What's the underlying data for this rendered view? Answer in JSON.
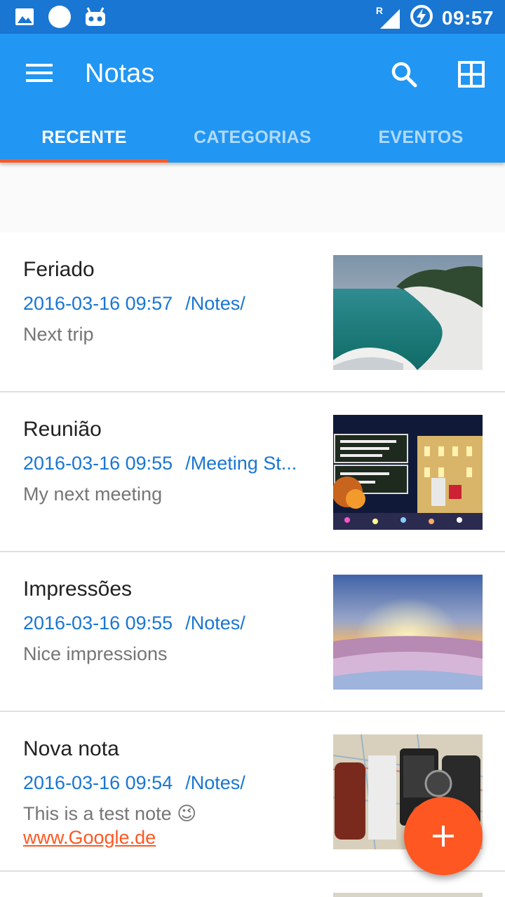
{
  "status_bar": {
    "time": "09:57",
    "left_icons": [
      "image-icon",
      "circle-icon",
      "robot-icon"
    ],
    "right_icons": [
      "signal-roaming-icon",
      "battery-charging-icon"
    ],
    "roaming_label": "R"
  },
  "appbar": {
    "title": "Notas",
    "menu_icon": "hamburger-menu-icon",
    "search_icon": "search-icon",
    "layout_icon": "grid-view-icon",
    "color": "#2196F3",
    "status_color": "#1976D2"
  },
  "tabs": [
    {
      "label": "RECENTE",
      "active": true
    },
    {
      "label": "CATEGORIAS",
      "active": false
    },
    {
      "label": "EVENTOS",
      "active": false
    }
  ],
  "accent_color": "#FF5722",
  "notes": [
    {
      "title": "Feriado",
      "date": "2016-03-16 09:57",
      "category": "/Notes/",
      "body": "Next trip",
      "link": "",
      "thumb": "coastline"
    },
    {
      "title": "Reunião",
      "date": "2016-03-16 09:55",
      "category": "/Meeting St...",
      "body": "My next meeting",
      "link": "",
      "thumb": "street-signs"
    },
    {
      "title": "Impressões",
      "date": "2016-03-16 09:55",
      "category": "/Notes/",
      "body": "Nice impressions",
      "link": "",
      "thumb": "sunset-snow"
    },
    {
      "title": "Nova nota",
      "date": "2016-03-16 09:54",
      "category": "/Notes/",
      "body": "This is a test note",
      "emoji": "😉",
      "link": "www.Google.de",
      "thumb": "gadgets-map"
    }
  ],
  "fab": {
    "icon": "plus-icon"
  }
}
